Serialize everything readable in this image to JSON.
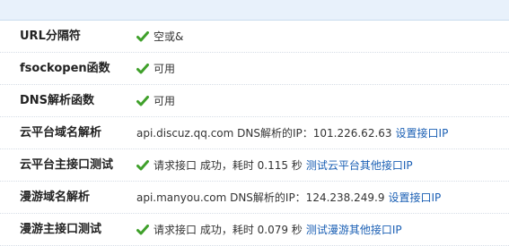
{
  "header": {
    "title": ""
  },
  "rows": [
    {
      "label": "URL分隔符",
      "check": true,
      "text": "空或&",
      "link": ""
    },
    {
      "label": "fsockopen函数",
      "check": true,
      "text": "可用",
      "link": ""
    },
    {
      "label": "DNS解析函数",
      "check": true,
      "text": "可用",
      "link": ""
    },
    {
      "label": "云平台域名解析",
      "check": false,
      "text": "api.discuz.qq.com DNS解析的IP：101.226.62.63",
      "link": "设置接口IP"
    },
    {
      "label": "云平台主接口测试",
      "check": true,
      "text": "请求接口 成功，耗时 0.115 秒",
      "link": "测试云平台其他接口IP"
    },
    {
      "label": "漫游域名解析",
      "check": false,
      "text": "api.manyou.com DNS解析的IP：124.238.249.9",
      "link": "设置接口IP"
    },
    {
      "label": "漫游主接口测试",
      "check": true,
      "text": "请求接口 成功，耗时 0.079 秒",
      "link": "测试漫游其他接口IP"
    }
  ],
  "colors": {
    "check": "#3fa02a",
    "link": "#1a5fb4"
  },
  "icons": {
    "check": "check-icon"
  }
}
